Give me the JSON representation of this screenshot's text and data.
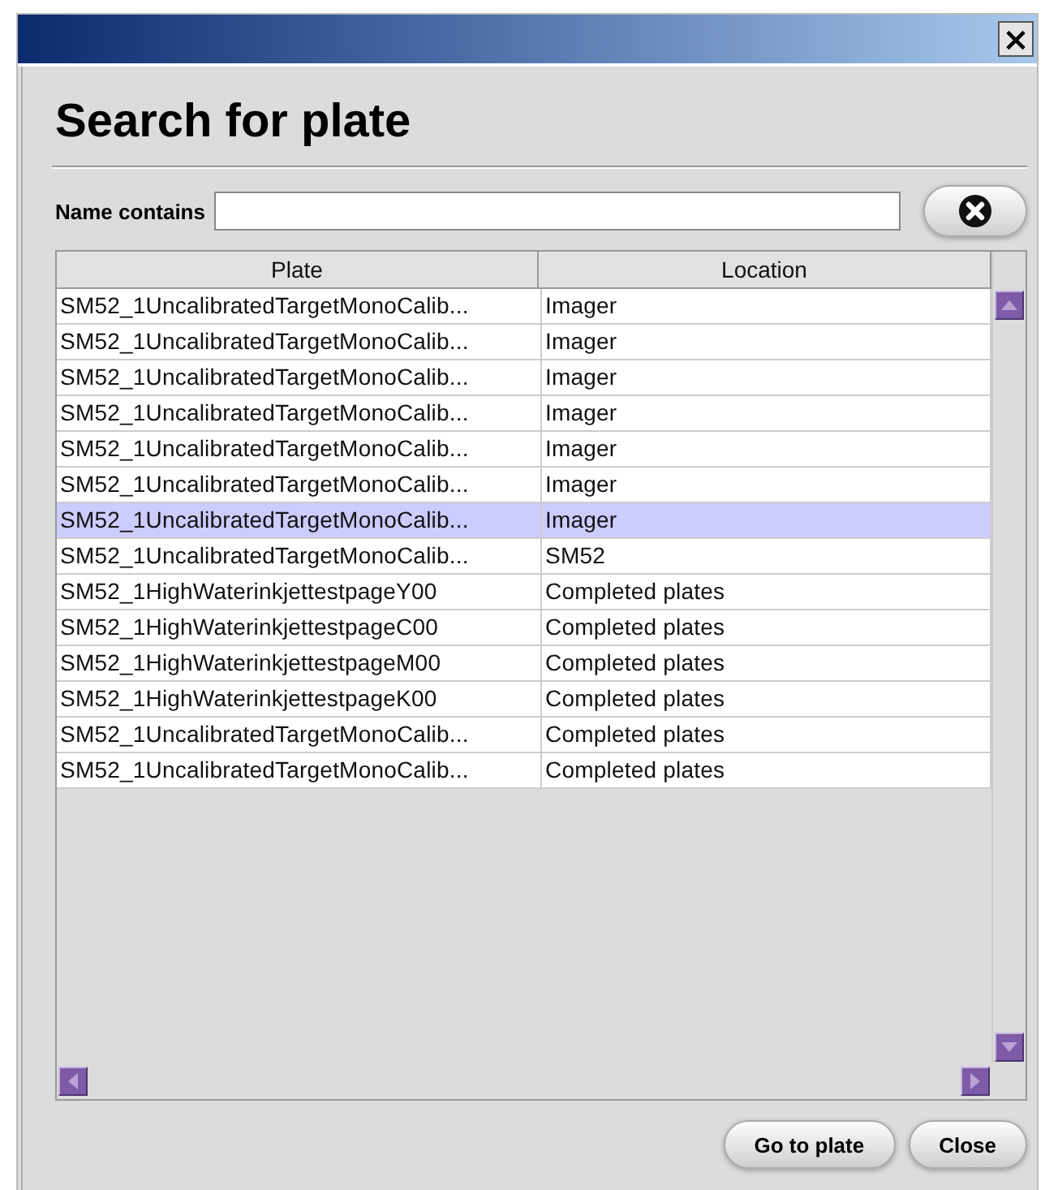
{
  "window": {
    "close_label": "×"
  },
  "heading": "Search for plate",
  "search": {
    "label": "Name contains"
  },
  "table": {
    "columns": [
      "Plate",
      "Location"
    ],
    "rows": [
      {
        "plate": "SM52_1UncalibratedTargetMonoCalib...",
        "location": "Imager",
        "selected": false
      },
      {
        "plate": "SM52_1UncalibratedTargetMonoCalib...",
        "location": "Imager",
        "selected": false
      },
      {
        "plate": "SM52_1UncalibratedTargetMonoCalib...",
        "location": "Imager",
        "selected": false
      },
      {
        "plate": "SM52_1UncalibratedTargetMonoCalib...",
        "location": "Imager",
        "selected": false
      },
      {
        "plate": "SM52_1UncalibratedTargetMonoCalib...",
        "location": "Imager",
        "selected": false
      },
      {
        "plate": "SM52_1UncalibratedTargetMonoCalib...",
        "location": "Imager",
        "selected": false
      },
      {
        "plate": "SM52_1UncalibratedTargetMonoCalib...",
        "location": "Imager",
        "selected": true
      },
      {
        "plate": "SM52_1UncalibratedTargetMonoCalib...",
        "location": "SM52",
        "selected": false
      },
      {
        "plate": "SM52_1HighWaterinkjettestpageY00",
        "location": "Completed plates",
        "selected": false
      },
      {
        "plate": "SM52_1HighWaterinkjettestpageC00",
        "location": "Completed plates",
        "selected": false
      },
      {
        "plate": "SM52_1HighWaterinkjettestpageM00",
        "location": "Completed plates",
        "selected": false
      },
      {
        "plate": "SM52_1HighWaterinkjettestpageK00",
        "location": "Completed plates",
        "selected": false
      },
      {
        "plate": "SM52_1UncalibratedTargetMonoCalib...",
        "location": "Completed plates",
        "selected": false
      },
      {
        "plate": "SM52_1UncalibratedTargetMonoCalib...",
        "location": "Completed plates",
        "selected": false
      }
    ]
  },
  "buttons": [
    "Go to plate",
    "Close"
  ]
}
